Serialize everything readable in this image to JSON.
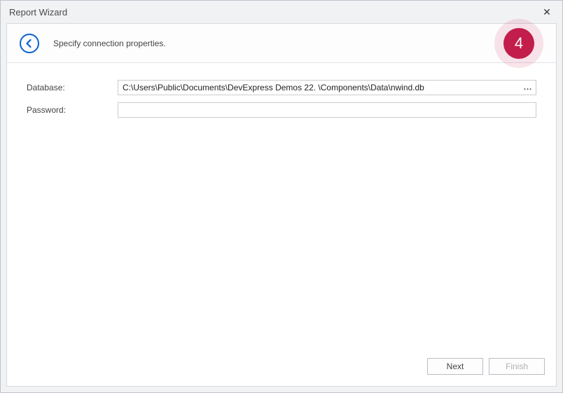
{
  "window": {
    "title": "Report Wizard",
    "close_glyph": "✕"
  },
  "header": {
    "subtitle": "Specify connection properties.",
    "step_number": "4"
  },
  "form": {
    "database": {
      "label": "Database:",
      "value": "C:\\Users\\Public\\Documents\\DevExpress Demos 22. \\Components\\Data\\nwind.db",
      "browse_glyph": "..."
    },
    "password": {
      "label": "Password:",
      "value": ""
    }
  },
  "buttons": {
    "next": "Next",
    "finish": "Finish"
  }
}
